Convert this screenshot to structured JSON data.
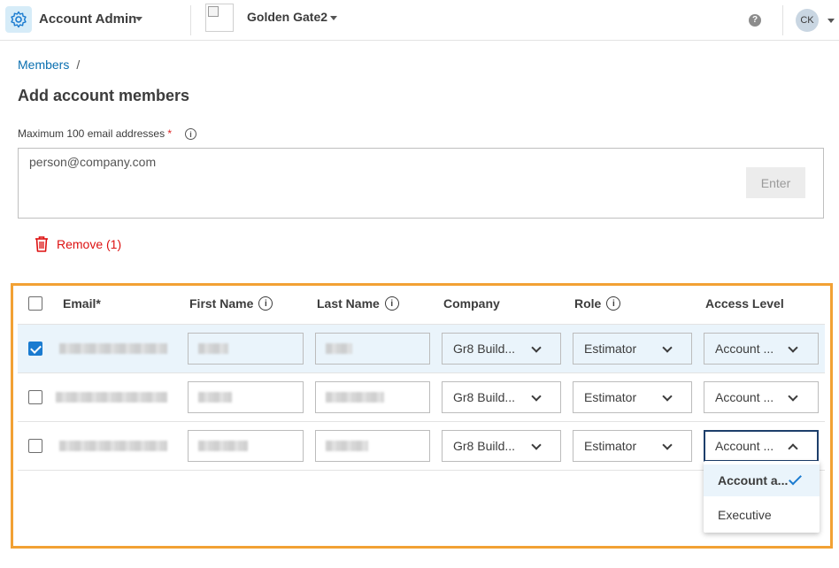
{
  "topbar": {
    "app_title": "Account Admin",
    "project_title": "Golden Gate2",
    "help_icon": "question-circle-icon",
    "avatar_initials": "CK"
  },
  "breadcrumb": {
    "items": [
      "Members"
    ],
    "separator": "/"
  },
  "page_title": "Add account members",
  "email_field": {
    "label": "Maximum 100 email addresses",
    "required_mark": "*",
    "placeholder": "person@company.com",
    "enter_label": "Enter"
  },
  "remove_label": "Remove (1)",
  "table": {
    "columns": [
      "Email*",
      "First Name",
      "Last Name",
      "Company",
      "Role",
      "Access Level"
    ],
    "rows": [
      {
        "selected": true,
        "company": "Gr8 Build...",
        "role": "Estimator",
        "access": "Account ..."
      },
      {
        "selected": false,
        "company": "Gr8 Build...",
        "role": "Estimator",
        "access": "Account ..."
      },
      {
        "selected": false,
        "company": "Gr8 Build...",
        "role": "Estimator",
        "access": "Account ..."
      }
    ]
  },
  "access_dropdown": {
    "options": [
      "Account a...",
      "Executive"
    ],
    "selected_index": 0
  },
  "colors": {
    "accent": "#1a7bd0",
    "link": "#0a6fb0",
    "danger": "#dd1111",
    "highlight_frame": "#f2a134",
    "selected_row": "#eaf4fb"
  }
}
